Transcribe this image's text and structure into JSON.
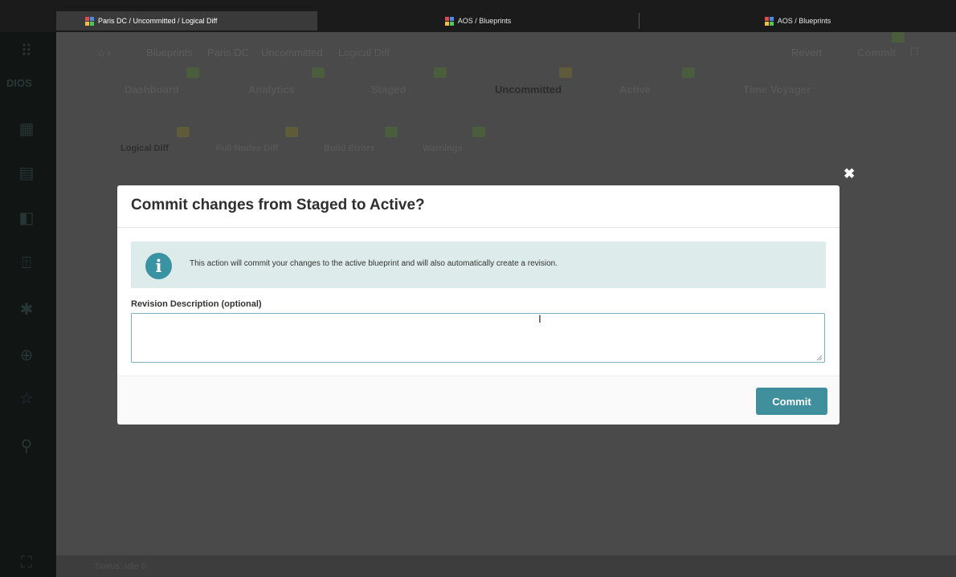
{
  "browser": {
    "tabs": [
      {
        "label": "Paris DC / Uncommitted / Logical Diff"
      },
      {
        "label": "AOS / Blueprints"
      },
      {
        "label": "AOS / Blueprints"
      }
    ]
  },
  "app": {
    "logo": "DIOS",
    "breadcrumb": [
      "Blueprints",
      "Paris DC",
      "Uncommitted",
      "Logical Diff"
    ],
    "actions": {
      "revert": "Revert",
      "commit": "Commit"
    },
    "main_tabs": [
      "Dashboard",
      "Analytics",
      "Staged",
      "Uncommitted",
      "Active",
      "Time Voyager"
    ],
    "sub_tabs": [
      "Logical Diff",
      "Full Nodes Diff",
      "Build Errors",
      "Warnings"
    ],
    "bottom_text": "Status: Idle 0"
  },
  "modal": {
    "title": "Commit changes from Staged to Active?",
    "info_icon": "i",
    "info_text": "This action will commit your changes to the active blueprint and will also automatically create a revision.",
    "field_label": "Revision Description (optional)",
    "field_value": "",
    "commit_label": "Commit",
    "close_icon": "✖"
  },
  "colors": {
    "accent": "#3f8f9d",
    "info_bg": "#ddebea",
    "info_icon": "#3a93a2"
  }
}
